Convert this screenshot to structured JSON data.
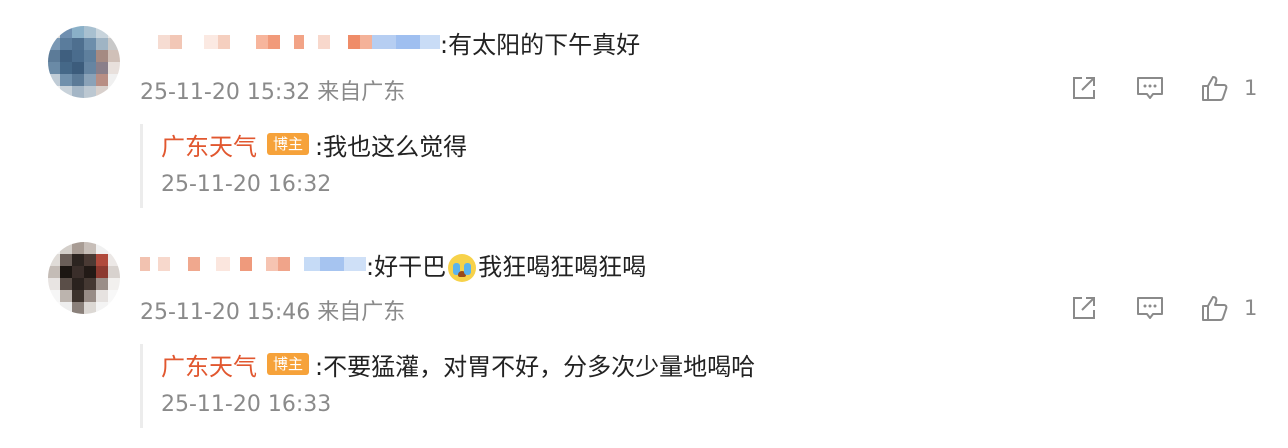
{
  "comments": [
    {
      "text": ":有太阳的下午真好",
      "meta": "25-11-20 15:32 来自广东",
      "likes": "1",
      "reply": {
        "author": "广东天气",
        "badge": "博主",
        "text": ":我也这么觉得",
        "time": "25-11-20 16:32"
      }
    },
    {
      "text_before": ":好干巴",
      "emoji_icon": "crying-face-emoji",
      "text_after": "我狂喝狂喝狂喝",
      "meta": "25-11-20 15:46 来自广东",
      "likes": "1",
      "reply": {
        "author": "广东天气",
        "badge": "博主",
        "text": ":不要猛灌，对胃不好，分多次少量地喝哈",
        "time": "25-11-20 16:33"
      }
    }
  ],
  "icons": {
    "share": "share-icon",
    "comment": "comment-icon",
    "like": "thumbs-up-icon"
  },
  "colors": {
    "author_link": "#e1572f",
    "badge_bg": "#f6a23a",
    "meta_text": "#8a8a8a",
    "reply_border": "#ececec"
  }
}
